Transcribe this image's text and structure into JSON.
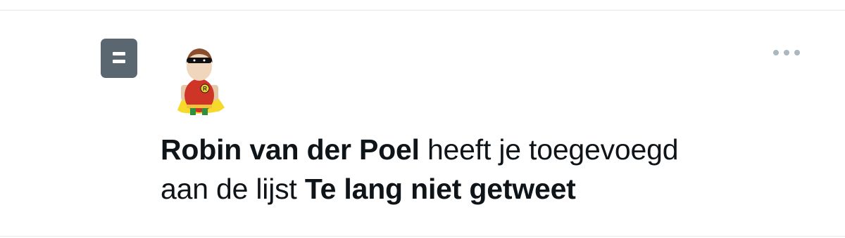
{
  "notification": {
    "user_name": "Robin van der Poel",
    "action_line1": "heeft je toegevoegd",
    "action_line2_prefix": "aan de lijst",
    "list_name": "Te lang niet getweet"
  },
  "icons": {
    "type_icon": "list-icon",
    "avatar": "robin-cartoon-avatar",
    "menu": "more-dots-icon"
  },
  "colors": {
    "list_icon_bg": "#5b6770",
    "text": "#0f1419",
    "more_dots": "#aab8c2",
    "divider": "#e6e9ec"
  }
}
